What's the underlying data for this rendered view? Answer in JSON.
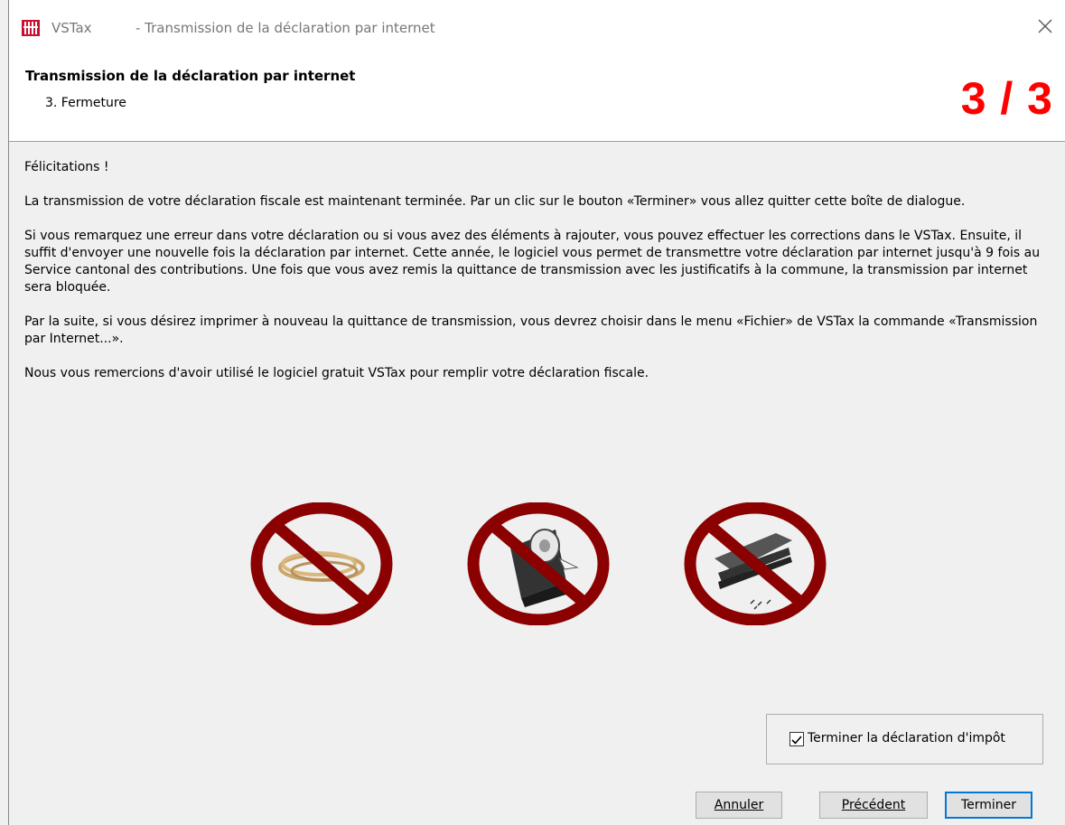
{
  "window": {
    "app_name": "VSTax",
    "title": "- Transmission de la déclaration par internet"
  },
  "header": {
    "title": "Transmission de la déclaration par internet",
    "step": "3. Fermeture",
    "counter": "3 / 3"
  },
  "content": {
    "paragraphs": [
      "Félicitations !",
      "La transmission de votre déclaration fiscale est maintenant terminée. Par un clic sur le bouton «Terminer» vous allez quitter cette boîte de dialogue.",
      "Si vous remarquez une erreur dans votre déclaration ou si vous avez des éléments à rajouter, vous pouvez effectuer les corrections dans le VSTax. Ensuite, il suffit d'envoyer une nouvelle fois la déclaration par internet. Cette année, le logiciel vous permet de transmettre votre déclaration par internet jusqu'à 9 fois au Service cantonal des contributions. Une fois que vous avez remis la quittance de transmission avec les justificatifs à la commune, la transmission par internet sera bloquée.",
      "Par la suite, si vous désirez imprimer à nouveau la quittance de transmission, vous devrez choisir dans le menu «Fichier» de VSTax la commande «Transmission par Internet...».",
      "Nous vous remercions d'avoir utilisé le logiciel gratuit VSTax pour remplir votre déclaration fiscale."
    ]
  },
  "icons": [
    "no-rubber-bands-icon",
    "no-tape-icon",
    "no-stapler-icon"
  ],
  "checkbox": {
    "label": "Terminer la déclaration d'impôt",
    "checked": true
  },
  "buttons": {
    "cancel": "Annuler",
    "previous": "Précédent",
    "finish": "Terminer"
  },
  "colors": {
    "counter": "#ff0000",
    "forbid": "#8b0000",
    "primary_border": "#0078d7"
  }
}
